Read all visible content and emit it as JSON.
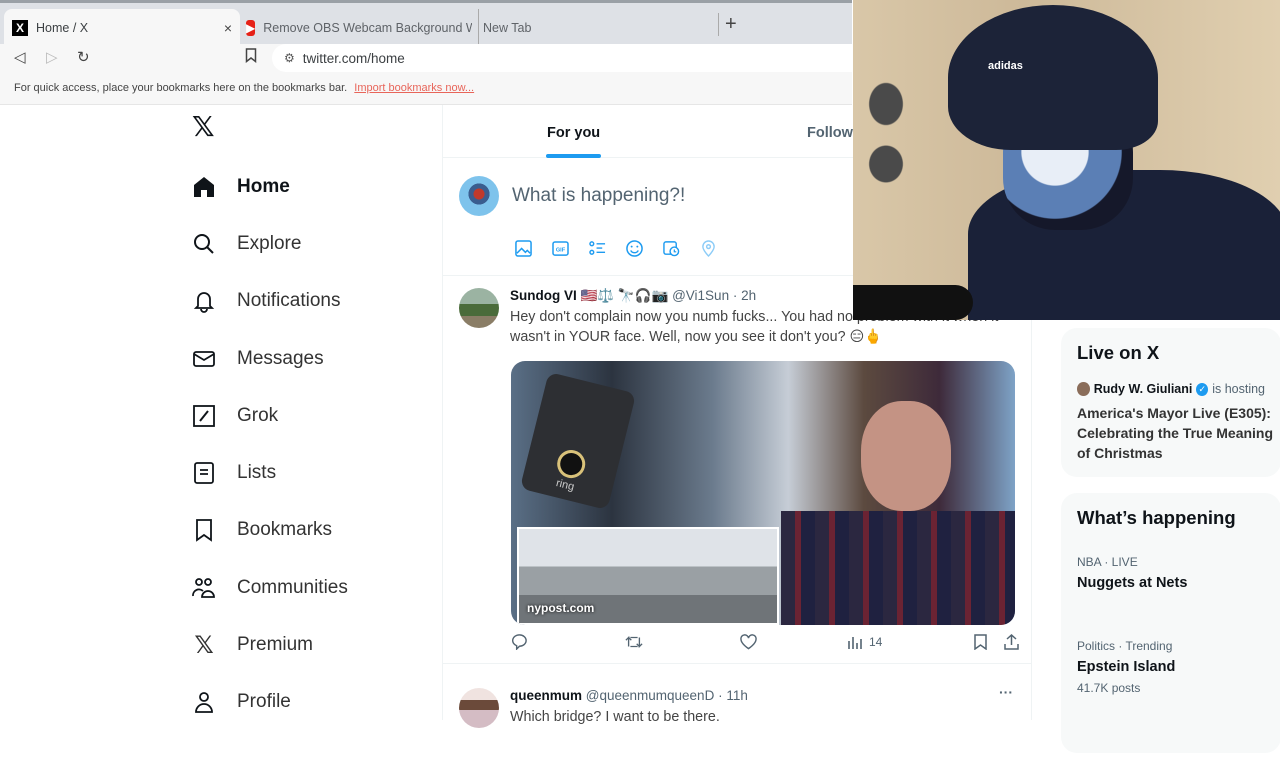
{
  "browser": {
    "tabs": [
      {
        "title": "Home / X",
        "icon": "x-logo-icon",
        "active": true
      },
      {
        "title": "Remove OBS Webcam Background W",
        "icon": "youtube-icon",
        "active": false
      },
      {
        "title": "New Tab",
        "icon": "",
        "active": false
      }
    ],
    "close_glyph": "×",
    "new_tab_glyph": "+",
    "url": "twitter.com/home",
    "bookmarks_bar_text": "For quick access, place your bookmarks here on the bookmarks bar.",
    "import_bookmarks_link": "Import bookmarks now..."
  },
  "sidebar": {
    "logo": "𝕏",
    "items": [
      {
        "label": "Home",
        "icon": "home-icon",
        "active": true
      },
      {
        "label": "Explore",
        "icon": "search-icon"
      },
      {
        "label": "Notifications",
        "icon": "bell-icon"
      },
      {
        "label": "Messages",
        "icon": "envelope-icon"
      },
      {
        "label": "Grok",
        "icon": "grok-icon"
      },
      {
        "label": "Lists",
        "icon": "list-icon"
      },
      {
        "label": "Bookmarks",
        "icon": "bookmark-icon"
      },
      {
        "label": "Communities",
        "icon": "communities-icon"
      },
      {
        "label": "Premium",
        "icon": "x-premium-icon"
      },
      {
        "label": "Profile",
        "icon": "profile-icon"
      }
    ]
  },
  "feed": {
    "tabs": [
      {
        "label": "For you",
        "active": true
      },
      {
        "label": "Followi"
      }
    ],
    "compose_placeholder": "What is happening?!",
    "posts": [
      {
        "name": "Sundog VI",
        "badges": "🇺🇸⚖️ 🔭🎧📷",
        "handle": "@Vi1Sun",
        "time": "· 2h",
        "text": "Hey don't complain now you numb fucks...  You had no problem with it when it wasn't in YOUR face. Well, now you see it don't you? 😑🖕",
        "media_label": "nypost.com",
        "media_brand": "ring",
        "views": "14"
      },
      {
        "name": "queenmum",
        "handle": "@queenmumqueenD",
        "time": "· 11h",
        "text": "Which bridge?  I want to be there."
      }
    ]
  },
  "right": {
    "live": {
      "title": "Live on X",
      "host": "Rudy W. Giuliani",
      "hosting": "is hosting",
      "space_title_lines": [
        "America's Mayor Live (E305):",
        "Celebrating the True Meaning",
        "of Christmas"
      ]
    },
    "trends": {
      "title": "What’s happening",
      "items": [
        {
          "meta": "NBA · LIVE",
          "name": "Nuggets at Nets"
        },
        {
          "meta": "Politics · Trending",
          "name": "Epstein Island",
          "count": "41.7K posts"
        }
      ]
    }
  },
  "webcam": {
    "cap_logo": "adidas"
  }
}
